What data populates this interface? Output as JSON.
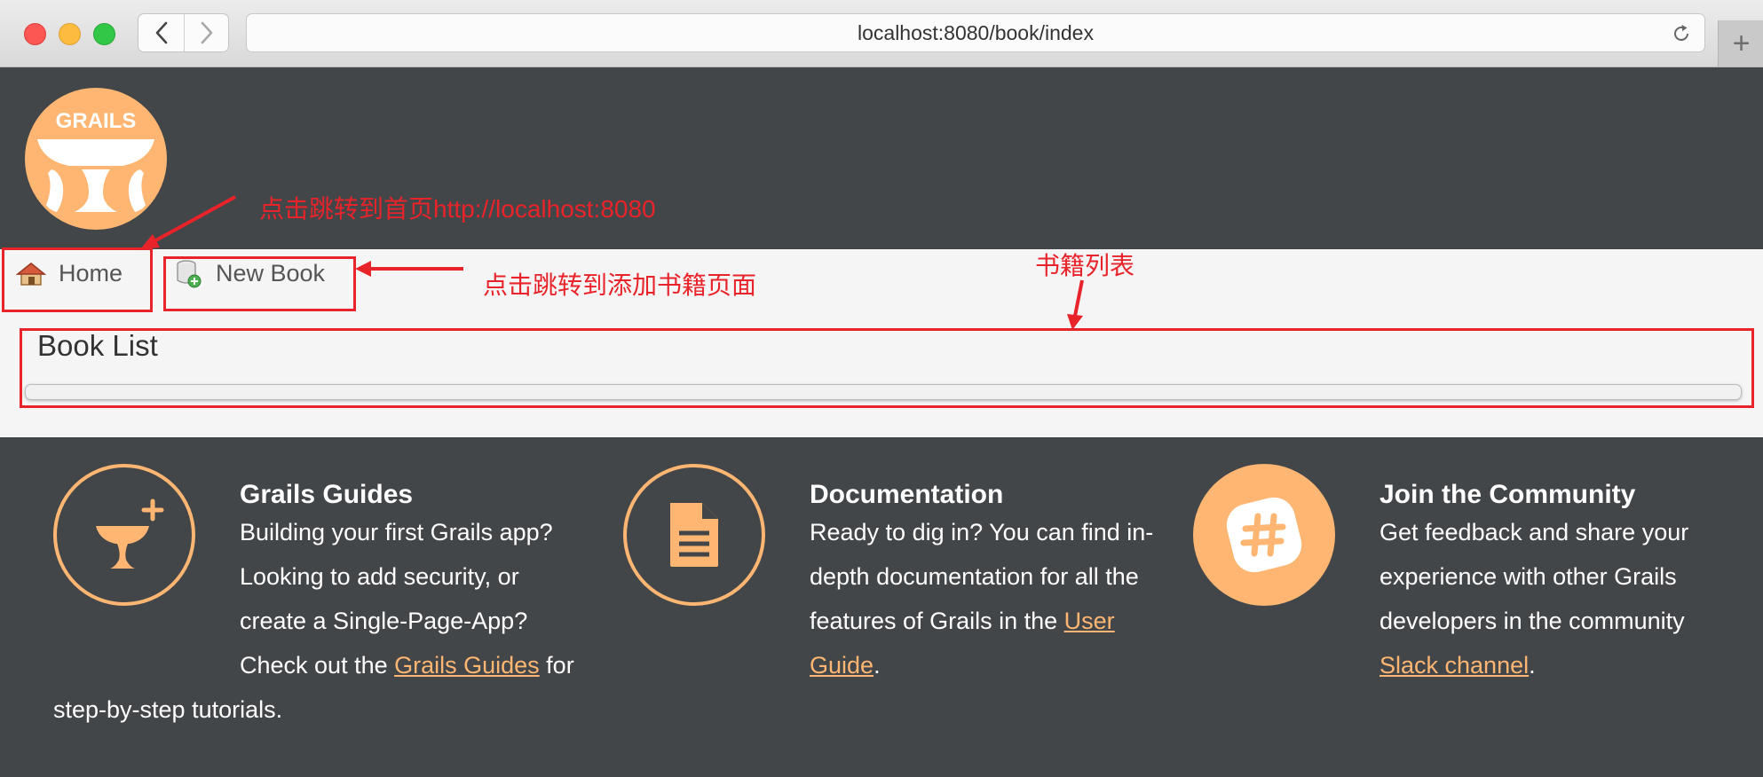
{
  "browser": {
    "url": "localhost:8080/book/index",
    "new_tab_label": "+"
  },
  "header": {
    "logo_text": "GRAILS"
  },
  "nav": {
    "home_label": "Home",
    "new_book_label": "New Book"
  },
  "main": {
    "title": "Book List"
  },
  "footer": {
    "guides": [
      {
        "title": "Grails Guides",
        "text_before": "Building your first Grails app? Looking to add security, or create a Single-Page-App? Check out the ",
        "link": "Grails Guides",
        "text_after": " for step-by-step tutorials."
      },
      {
        "title": "Documentation",
        "text_before": "Ready to dig in? You can find in-depth documentation for all the features of Grails in the ",
        "link": "User Guide",
        "text_after": "."
      },
      {
        "title": "Join the Community",
        "text_before": "Get feedback and share your experience with other Grails developers in the community ",
        "link": "Slack channel",
        "text_after": "."
      }
    ]
  },
  "annotations": {
    "home_note": "点击跳转到首页http://localhost:8080",
    "new_book_note": "点击跳转到添加书籍页面",
    "list_note": "书籍列表"
  },
  "colors": {
    "accent": "#feb672",
    "background": "#434649",
    "annotation": "#e8232a"
  }
}
